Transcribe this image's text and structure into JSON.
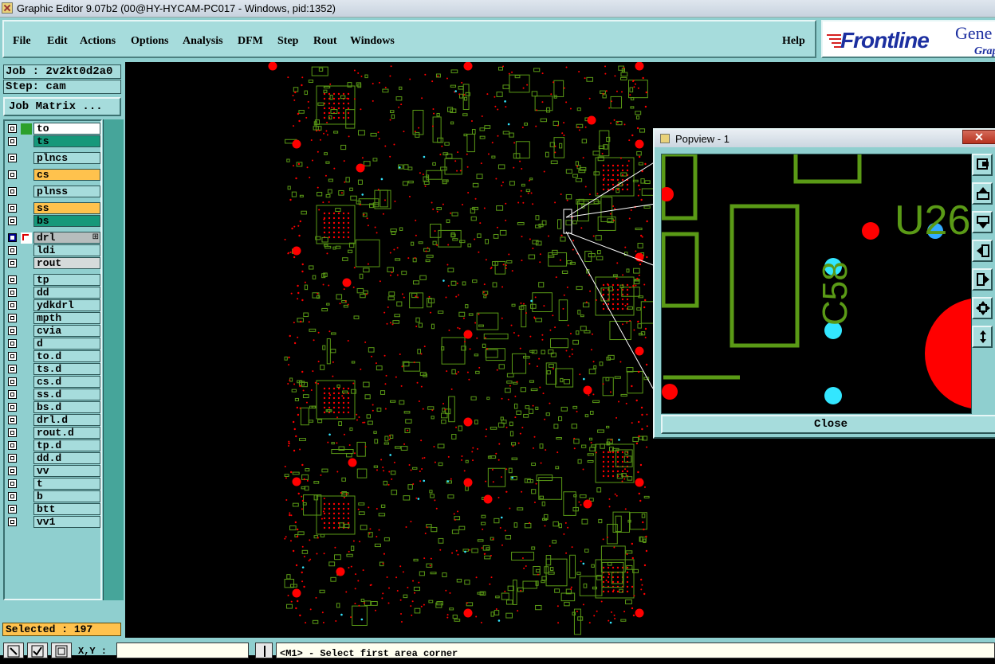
{
  "window": {
    "title": "Graphic Editor 9.07b2 (00@HY-HYCAM-PC017 - Windows, pid:1352)"
  },
  "menu": {
    "items": [
      "File",
      "Edit",
      "Actions",
      "Options",
      "Analysis",
      "DFM",
      "Step",
      "Rout",
      "Windows"
    ],
    "help": "Help"
  },
  "brand": {
    "name": "Frontline",
    "product": "Gene",
    "sub": "Grap"
  },
  "job": {
    "label": "Job : 2v2kt0d2a0",
    "step": "Step: cam",
    "matrix_button": "Job Matrix ..."
  },
  "layers": [
    {
      "name": "to",
      "color": "white",
      "mark": "green",
      "gap": false
    },
    {
      "name": "ts",
      "color": "teal",
      "mark": "",
      "gap": false
    },
    {
      "name": "plncs",
      "color": "default",
      "mark": "",
      "gap": true
    },
    {
      "name": "cs",
      "color": "orange",
      "mark": "",
      "gap": true
    },
    {
      "name": "plnss",
      "color": "default",
      "mark": "",
      "gap": true
    },
    {
      "name": "ss",
      "color": "orange",
      "mark": "",
      "gap": true
    },
    {
      "name": "bs",
      "color": "teal",
      "mark": "",
      "gap": false
    },
    {
      "name": "drl",
      "color": "gray",
      "mark": "arrow",
      "gap": true,
      "selected": true
    },
    {
      "name": "ldi",
      "color": "default",
      "mark": "",
      "gap": false
    },
    {
      "name": "rout",
      "color": "lgray",
      "mark": "",
      "gap": false
    },
    {
      "name": "tp",
      "color": "default",
      "mark": "",
      "gap": true
    },
    {
      "name": "dd",
      "color": "default",
      "mark": "",
      "gap": false
    },
    {
      "name": "ydkdrl",
      "color": "default",
      "mark": "",
      "gap": false
    },
    {
      "name": "mpth",
      "color": "default",
      "mark": "",
      "gap": false
    },
    {
      "name": "cvia",
      "color": "default",
      "mark": "",
      "gap": false
    },
    {
      "name": "d",
      "color": "default",
      "mark": "",
      "gap": false
    },
    {
      "name": "to.d",
      "color": "default",
      "mark": "",
      "gap": false
    },
    {
      "name": "ts.d",
      "color": "default",
      "mark": "",
      "gap": false
    },
    {
      "name": "cs.d",
      "color": "default",
      "mark": "",
      "gap": false
    },
    {
      "name": "ss.d",
      "color": "default",
      "mark": "",
      "gap": false
    },
    {
      "name": "bs.d",
      "color": "default",
      "mark": "",
      "gap": false
    },
    {
      "name": "drl.d",
      "color": "default",
      "mark": "",
      "gap": false
    },
    {
      "name": "rout.d",
      "color": "default",
      "mark": "",
      "gap": false
    },
    {
      "name": "tp.d",
      "color": "default",
      "mark": "",
      "gap": false
    },
    {
      "name": "dd.d",
      "color": "default",
      "mark": "",
      "gap": false
    },
    {
      "name": "vv",
      "color": "default",
      "mark": "",
      "gap": false
    },
    {
      "name": "t",
      "color": "default",
      "mark": "",
      "gap": false
    },
    {
      "name": "b",
      "color": "default",
      "mark": "",
      "gap": false
    },
    {
      "name": "btt",
      "color": "default",
      "mark": "",
      "gap": false
    },
    {
      "name": "vv1",
      "color": "default",
      "mark": "",
      "gap": false
    }
  ],
  "status": {
    "selected": "Selected : 197",
    "xy_label": "X,Y :",
    "message": "<M1> - Select first area corner"
  },
  "popview": {
    "title": "Popview - 1",
    "close_x": "✕",
    "close_button": "Close",
    "labels": [
      "U26",
      "C58"
    ],
    "tools": [
      "zoom-fit-icon",
      "pan-up-icon",
      "pan-down-icon",
      "pan-left-icon",
      "pan-right-icon",
      "zoom-in-icon",
      "zoom-out-icon"
    ]
  },
  "colors": {
    "panel": "#8fcfcf",
    "copper": "#5a9a16",
    "drill": "#ff0000",
    "via": "#33e6ff"
  }
}
